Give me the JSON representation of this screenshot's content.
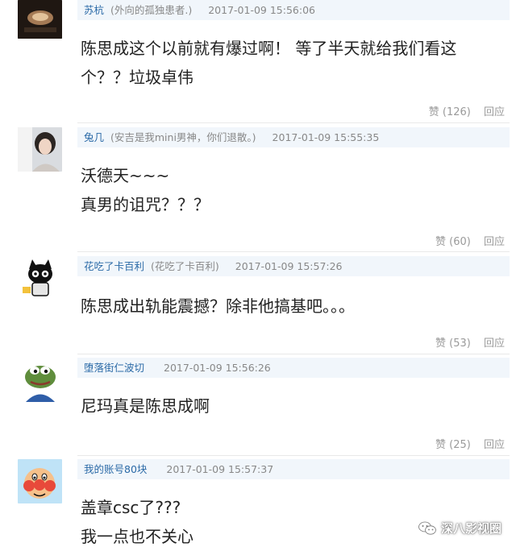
{
  "comments": [
    {
      "name": "苏杭",
      "remark": "(外向的孤独患者.)",
      "time": "2017-01-09 15:56:06",
      "lines": [
        "陈思成这个以前就有爆过啊！ 等了半天就给我们看这",
        "个？？垃圾卓伟"
      ],
      "like_label": "赞 (126)",
      "like_count": 126,
      "reply_label": "回应"
    },
    {
      "name": "兔几",
      "remark": "(安吉是我mini男神，你们退散。)",
      "time": "2017-01-09 15:55:35",
      "lines": [
        "沃德天~~~",
        "真男的诅咒？？？"
      ],
      "like_label": "赞 (60)",
      "like_count": 60,
      "reply_label": "回应"
    },
    {
      "name": "花吃了卡百利",
      "remark": "(花吃了卡百利)",
      "time": "2017-01-09 15:57:26",
      "lines": [
        "陈思成出轨能震撼？除非他搞基吧。。。"
      ],
      "like_label": "赞 (53)",
      "like_count": 53,
      "reply_label": "回应"
    },
    {
      "name": "堕落街仁波切",
      "remark": "",
      "time": "2017-01-09 15:56:26",
      "lines": [
        "尼玛真是陈思成啊"
      ],
      "like_label": "赞 (25)",
      "like_count": 25,
      "reply_label": "回应"
    },
    {
      "name": "我的账号80块",
      "remark": "",
      "time": "2017-01-09 15:57:37",
      "lines": [
        "盖章csc了???",
        "我一点也不关心"
      ],
      "like_label": "",
      "reply_label": ""
    }
  ],
  "watermark": {
    "text": "深八影视圈"
  },
  "colors": {
    "name": "#2b6aa7",
    "meta": "#888888",
    "header_bg": "#f1f6fb",
    "action": "#9a9a9a"
  },
  "icons": [
    "avatar-photo-1",
    "avatar-photo-2",
    "avatar-cartoon-cat",
    "avatar-pepe-frog",
    "avatar-cartoon-face",
    "wechat-icon"
  ]
}
